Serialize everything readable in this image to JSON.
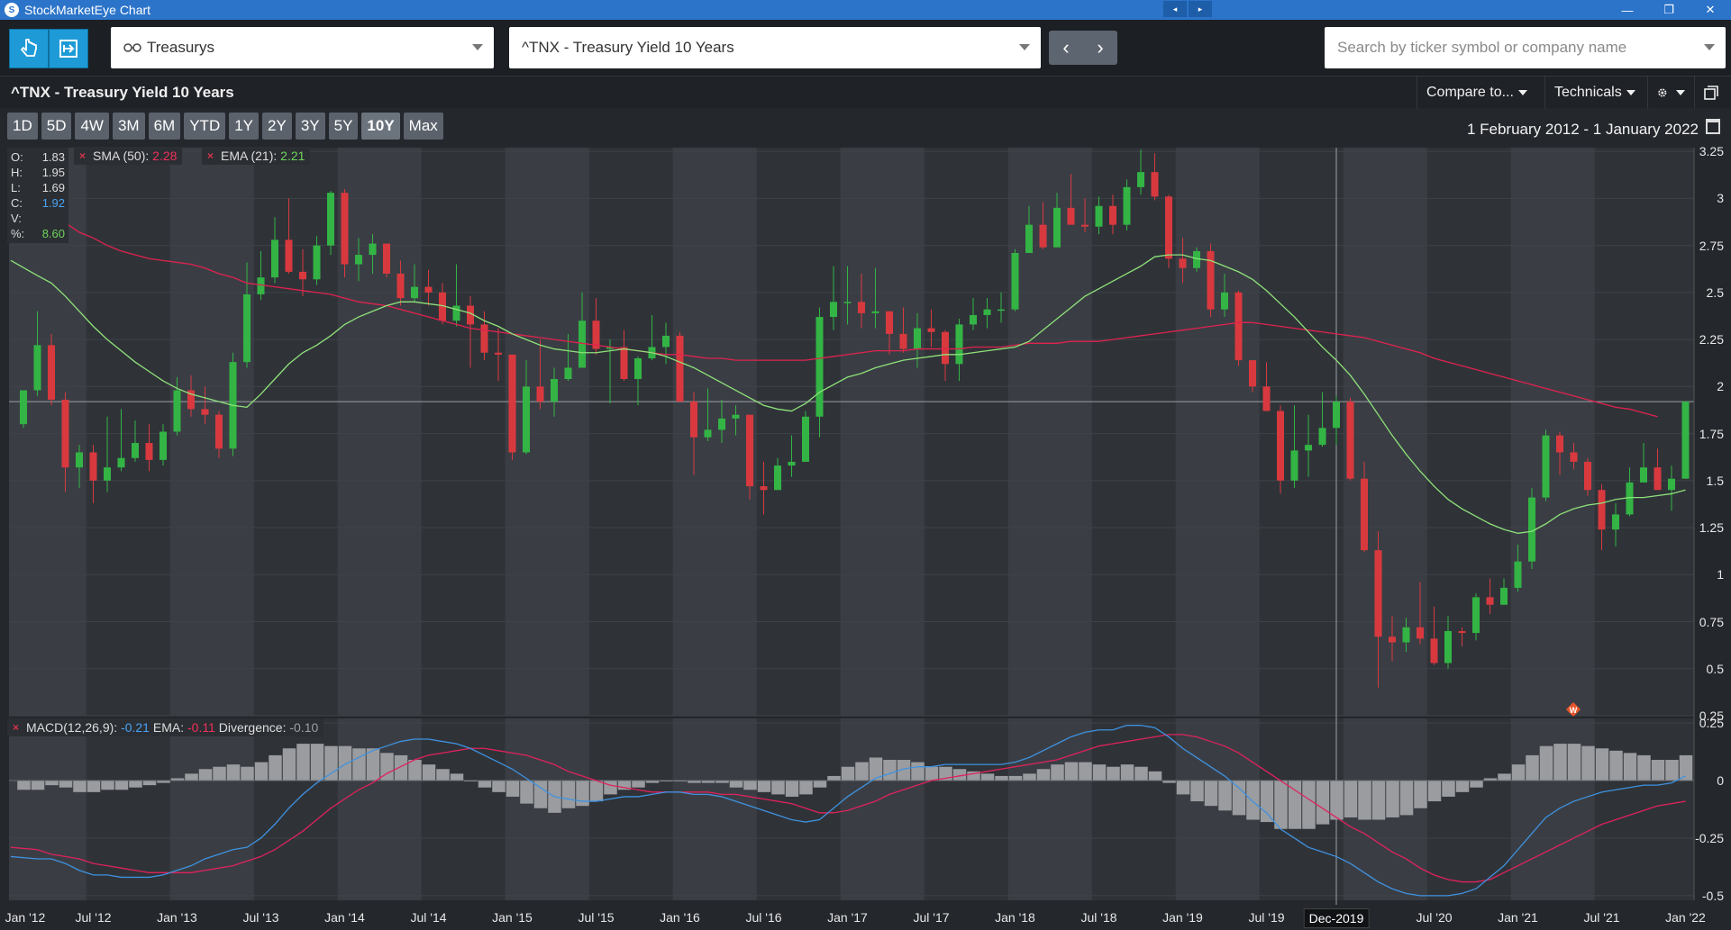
{
  "window": {
    "title": "StockMarketEye Chart",
    "minimize": "—",
    "maximize": "❐",
    "close": "✕",
    "nav_prev": "◂",
    "nav_next": "▸"
  },
  "toolbar": {
    "watchlist": "Treasurys",
    "security": "^TNX - Treasury Yield 10 Years",
    "prev": "‹",
    "next": "›",
    "search_placeholder": "Search by ticker symbol or company name"
  },
  "header": {
    "title": "^TNX - Treasury Yield 10 Years",
    "compare": "Compare to...",
    "technicals": "Technicals",
    "settings_icon": "gear-icon",
    "window_icon": "popout-icon"
  },
  "ranges": {
    "items": [
      "1D",
      "5D",
      "4W",
      "3M",
      "6M",
      "YTD",
      "1Y",
      "2Y",
      "3Y",
      "5Y",
      "10Y",
      "Max"
    ],
    "active": "10Y"
  },
  "date_range": "1 February 2012 - 1 January 2022",
  "ohlc": {
    "o_label": "O:",
    "o": "1.83",
    "h_label": "H:",
    "h": "1.95",
    "l_label": "L:",
    "l": "1.69",
    "c_label": "C:",
    "c": "1.92",
    "v_label": "V:",
    "v": "",
    "pct_label": "%:",
    "pct": "8.60"
  },
  "indicators": {
    "sma_label": "SMA (50):",
    "sma_value": "2.28",
    "ema_label": "EMA (21):",
    "ema_value": "2.21",
    "remove": "×"
  },
  "macd": {
    "label": "MACD(12,26,9):",
    "value": "-0.21",
    "ema_label": "EMA:",
    "ema_value": "-0.11",
    "div_label": "Divergence:",
    "div_value": "-0.10",
    "remove": "×"
  },
  "crosshair": {
    "label": "Dec-2019",
    "price": 1.92
  },
  "colors": {
    "up": "#33b445",
    "down": "#d8393f",
    "sma": "#e0224f",
    "ema": "#8fe27a",
    "macd": "#3f92e0",
    "signal": "#e0225c",
    "histogram": "#9a9ca0"
  },
  "chart_data": {
    "type": "candlestick",
    "xlabels": [
      "Jan '12",
      "Jul '12",
      "Jan '13",
      "Jul '13",
      "Jan '14",
      "Jul '14",
      "Jan '15",
      "Jul '15",
      "Jan '16",
      "Jul '16",
      "Jan '17",
      "Jul '17",
      "Jan '18",
      "Jul '18",
      "Jan '19",
      "Jul '19",
      "Jul '20",
      "Jan '21",
      "Jul '21",
      "Jan '22"
    ],
    "price_ticks": [
      "0.25",
      "0.5",
      "0.75",
      "1",
      "1.25",
      "1.5",
      "1.75",
      "2",
      "2.25",
      "2.5",
      "2.75",
      "3",
      "3.25"
    ],
    "macd_ticks": [
      "-0.5",
      "-0.25",
      "0",
      "0.25"
    ],
    "ylim": [
      0.25,
      3.27
    ],
    "macd_ylim": [
      -0.52,
      0.27
    ],
    "start": "2012-02",
    "months": [
      "2012-02",
      "2012-03",
      "2012-04",
      "2012-05",
      "2012-06",
      "2012-07",
      "2012-08",
      "2012-09",
      "2012-10",
      "2012-11",
      "2012-12",
      "2013-01",
      "2013-02",
      "2013-03",
      "2013-04",
      "2013-05",
      "2013-06",
      "2013-07",
      "2013-08",
      "2013-09",
      "2013-10",
      "2013-11",
      "2013-12",
      "2014-01",
      "2014-02",
      "2014-03",
      "2014-04",
      "2014-05",
      "2014-06",
      "2014-07",
      "2014-08",
      "2014-09",
      "2014-10",
      "2014-11",
      "2014-12",
      "2015-01",
      "2015-02",
      "2015-03",
      "2015-04",
      "2015-05",
      "2015-06",
      "2015-07",
      "2015-08",
      "2015-09",
      "2015-10",
      "2015-11",
      "2015-12",
      "2016-01",
      "2016-02",
      "2016-03",
      "2016-04",
      "2016-05",
      "2016-06",
      "2016-07",
      "2016-08",
      "2016-09",
      "2016-10",
      "2016-11",
      "2016-12",
      "2017-01",
      "2017-02",
      "2017-03",
      "2017-04",
      "2017-05",
      "2017-06",
      "2017-07",
      "2017-08",
      "2017-09",
      "2017-10",
      "2017-11",
      "2017-12",
      "2018-01",
      "2018-02",
      "2018-03",
      "2018-04",
      "2018-05",
      "2018-06",
      "2018-07",
      "2018-08",
      "2018-09",
      "2018-10",
      "2018-11",
      "2018-12",
      "2019-01",
      "2019-02",
      "2019-03",
      "2019-04",
      "2019-05",
      "2019-06",
      "2019-07",
      "2019-08",
      "2019-09",
      "2019-10",
      "2019-11",
      "2019-12",
      "2020-01",
      "2020-02",
      "2020-03",
      "2020-04",
      "2020-05",
      "2020-06",
      "2020-07",
      "2020-08",
      "2020-09",
      "2020-10",
      "2020-11",
      "2020-12",
      "2021-01",
      "2021-02",
      "2021-03",
      "2021-04",
      "2021-05",
      "2021-06",
      "2021-07",
      "2021-08",
      "2021-09",
      "2021-10",
      "2021-11",
      "2021-12",
      "2022-01"
    ],
    "ohlc": [
      [
        1.8,
        1.98,
        1.78,
        1.98
      ],
      [
        1.98,
        2.4,
        1.95,
        2.22
      ],
      [
        2.22,
        2.28,
        1.9,
        1.93
      ],
      [
        1.93,
        1.97,
        1.44,
        1.57
      ],
      [
        1.57,
        1.69,
        1.46,
        1.65
      ],
      [
        1.65,
        1.69,
        1.38,
        1.5
      ],
      [
        1.5,
        1.84,
        1.44,
        1.57
      ],
      [
        1.57,
        1.88,
        1.55,
        1.62
      ],
      [
        1.62,
        1.82,
        1.6,
        1.7
      ],
      [
        1.7,
        1.8,
        1.55,
        1.61
      ],
      [
        1.61,
        1.8,
        1.58,
        1.76
      ],
      [
        1.76,
        2.05,
        1.74,
        1.98
      ],
      [
        1.98,
        2.06,
        1.84,
        1.88
      ],
      [
        1.88,
        2.0,
        1.8,
        1.85
      ],
      [
        1.85,
        1.87,
        1.62,
        1.67
      ],
      [
        1.67,
        2.18,
        1.63,
        2.13
      ],
      [
        2.13,
        2.66,
        2.1,
        2.49
      ],
      [
        2.49,
        2.72,
        2.46,
        2.58
      ],
      [
        2.58,
        2.9,
        2.55,
        2.78
      ],
      [
        2.78,
        3.0,
        2.6,
        2.61
      ],
      [
        2.61,
        2.73,
        2.48,
        2.57
      ],
      [
        2.57,
        2.8,
        2.54,
        2.75
      ],
      [
        2.75,
        3.04,
        2.7,
        3.03
      ],
      [
        3.03,
        3.05,
        2.58,
        2.65
      ],
      [
        2.65,
        2.79,
        2.56,
        2.7
      ],
      [
        2.7,
        2.81,
        2.6,
        2.76
      ],
      [
        2.76,
        2.76,
        2.58,
        2.6
      ],
      [
        2.6,
        2.67,
        2.43,
        2.47
      ],
      [
        2.47,
        2.65,
        2.45,
        2.53
      ],
      [
        2.53,
        2.62,
        2.43,
        2.5
      ],
      [
        2.5,
        2.55,
        2.33,
        2.35
      ],
      [
        2.35,
        2.65,
        2.32,
        2.43
      ],
      [
        2.43,
        2.48,
        2.1,
        2.33
      ],
      [
        2.33,
        2.4,
        2.14,
        2.18
      ],
      [
        2.18,
        2.31,
        2.03,
        2.17
      ],
      [
        2.17,
        2.12,
        1.61,
        1.65
      ],
      [
        1.65,
        2.14,
        1.64,
        2.0
      ],
      [
        2.0,
        2.25,
        1.88,
        1.92
      ],
      [
        1.92,
        2.1,
        1.84,
        2.04
      ],
      [
        2.04,
        2.28,
        2.03,
        2.1
      ],
      [
        2.1,
        2.5,
        2.1,
        2.35
      ],
      [
        2.35,
        2.47,
        2.17,
        2.2
      ],
      [
        2.2,
        2.25,
        1.91,
        2.21
      ],
      [
        2.21,
        2.3,
        2.03,
        2.04
      ],
      [
        2.04,
        2.16,
        1.9,
        2.15
      ],
      [
        2.15,
        2.38,
        2.14,
        2.21
      ],
      [
        2.21,
        2.34,
        2.12,
        2.27
      ],
      [
        2.27,
        2.29,
        1.97,
        1.92
      ],
      [
        1.92,
        1.97,
        1.53,
        1.73
      ],
      [
        1.73,
        1.99,
        1.71,
        1.77
      ],
      [
        1.77,
        1.93,
        1.7,
        1.83
      ],
      [
        1.83,
        1.9,
        1.74,
        1.85
      ],
      [
        1.85,
        1.8,
        1.4,
        1.47
      ],
      [
        1.47,
        1.6,
        1.32,
        1.45
      ],
      [
        1.45,
        1.62,
        1.48,
        1.58
      ],
      [
        1.58,
        1.74,
        1.52,
        1.6
      ],
      [
        1.6,
        1.87,
        1.6,
        1.84
      ],
      [
        1.84,
        2.42,
        1.73,
        2.37
      ],
      [
        2.37,
        2.64,
        2.3,
        2.45
      ],
      [
        2.45,
        2.64,
        2.33,
        2.45
      ],
      [
        2.45,
        2.6,
        2.31,
        2.39
      ],
      [
        2.39,
        2.63,
        2.31,
        2.4
      ],
      [
        2.4,
        2.4,
        2.17,
        2.28
      ],
      [
        2.28,
        2.42,
        2.18,
        2.2
      ],
      [
        2.2,
        2.39,
        2.1,
        2.31
      ],
      [
        2.31,
        2.41,
        2.21,
        2.29
      ],
      [
        2.29,
        2.3,
        2.03,
        2.12
      ],
      [
        2.12,
        2.36,
        2.03,
        2.33
      ],
      [
        2.33,
        2.47,
        2.3,
        2.38
      ],
      [
        2.38,
        2.47,
        2.31,
        2.41
      ],
      [
        2.41,
        2.5,
        2.34,
        2.41
      ],
      [
        2.41,
        2.73,
        2.4,
        2.71
      ],
      [
        2.71,
        2.96,
        2.71,
        2.86
      ],
      [
        2.86,
        2.98,
        2.73,
        2.74
      ],
      [
        2.74,
        3.03,
        2.75,
        2.95
      ],
      [
        2.95,
        3.13,
        2.94,
        2.86
      ],
      [
        2.86,
        3.0,
        2.82,
        2.85
      ],
      [
        2.85,
        3.01,
        2.81,
        2.96
      ],
      [
        2.96,
        3.02,
        2.81,
        2.86
      ],
      [
        2.86,
        3.1,
        2.83,
        3.06
      ],
      [
        3.06,
        3.26,
        3.02,
        3.14
      ],
      [
        3.14,
        3.24,
        2.99,
        3.01
      ],
      [
        3.01,
        3.02,
        2.63,
        2.68
      ],
      [
        2.68,
        2.79,
        2.55,
        2.63
      ],
      [
        2.63,
        2.74,
        2.61,
        2.72
      ],
      [
        2.72,
        2.76,
        2.37,
        2.41
      ],
      [
        2.41,
        2.6,
        2.37,
        2.5
      ],
      [
        2.5,
        2.51,
        2.11,
        2.14
      ],
      [
        2.14,
        2.14,
        1.97,
        2.0
      ],
      [
        2.0,
        2.13,
        1.97,
        1.87
      ],
      [
        1.87,
        1.9,
        1.43,
        1.5
      ],
      [
        1.5,
        1.9,
        1.46,
        1.66
      ],
      [
        1.66,
        1.85,
        1.52,
        1.69
      ],
      [
        1.69,
        1.97,
        1.68,
        1.78
      ],
      [
        1.78,
        1.95,
        1.69,
        1.92
      ],
      [
        1.92,
        1.94,
        1.5,
        1.51
      ],
      [
        1.51,
        1.6,
        1.12,
        1.13
      ],
      [
        1.13,
        1.23,
        0.4,
        0.67
      ],
      [
        0.67,
        0.78,
        0.54,
        0.64
      ],
      [
        0.64,
        0.77,
        0.59,
        0.72
      ],
      [
        0.72,
        0.96,
        0.63,
        0.66
      ],
      [
        0.66,
        0.83,
        0.52,
        0.53
      ],
      [
        0.53,
        0.78,
        0.5,
        0.7
      ],
      [
        0.7,
        0.72,
        0.62,
        0.69
      ],
      [
        0.69,
        0.9,
        0.65,
        0.88
      ],
      [
        0.88,
        0.98,
        0.79,
        0.84
      ],
      [
        0.84,
        0.98,
        0.85,
        0.93
      ],
      [
        0.93,
        1.16,
        0.91,
        1.07
      ],
      [
        1.07,
        1.46,
        1.03,
        1.41
      ],
      [
        1.41,
        1.77,
        1.39,
        1.74
      ],
      [
        1.74,
        1.76,
        1.53,
        1.65
      ],
      [
        1.65,
        1.7,
        1.56,
        1.6
      ],
      [
        1.6,
        1.62,
        1.42,
        1.45
      ],
      [
        1.45,
        1.48,
        1.13,
        1.24
      ],
      [
        1.24,
        1.38,
        1.15,
        1.32
      ],
      [
        1.32,
        1.57,
        1.31,
        1.49
      ],
      [
        1.49,
        1.7,
        1.52,
        1.57
      ],
      [
        1.57,
        1.67,
        1.45,
        1.45
      ],
      [
        1.45,
        1.58,
        1.34,
        1.51
      ],
      [
        1.51,
        1.89,
        1.52,
        1.92
      ]
    ],
    "sma50": [
      3.0,
      2.96,
      2.91,
      2.87,
      2.82,
      2.79,
      2.75,
      2.72,
      2.7,
      2.68,
      2.67,
      2.66,
      2.65,
      2.63,
      2.6,
      2.58,
      2.55,
      2.54,
      2.53,
      2.52,
      2.51,
      2.5,
      2.49,
      2.47,
      2.45,
      2.44,
      2.43,
      2.41,
      2.39,
      2.37,
      2.35,
      2.33,
      2.31,
      2.3,
      2.29,
      2.28,
      2.27,
      2.26,
      2.25,
      2.24,
      2.23,
      2.22,
      2.21,
      2.2,
      2.19,
      2.18,
      2.17,
      2.17,
      2.16,
      2.15,
      2.15,
      2.14,
      2.14,
      2.14,
      2.14,
      2.14,
      2.14,
      2.15,
      2.16,
      2.17,
      2.18,
      2.19,
      2.19,
      2.19,
      2.2,
      2.2,
      2.2,
      2.2,
      2.21,
      2.21,
      2.21,
      2.22,
      2.23,
      2.23,
      2.23,
      2.24,
      2.24,
      2.24,
      2.25,
      2.26,
      2.27,
      2.28,
      2.29,
      2.3,
      2.31,
      2.32,
      2.33,
      2.34,
      2.34,
      2.33,
      2.32,
      2.31,
      2.3,
      2.29,
      2.28,
      2.27,
      2.26,
      2.24,
      2.22,
      2.2,
      2.18,
      2.15,
      2.13,
      2.11,
      2.09,
      2.07,
      2.05,
      2.03,
      2.01,
      1.99,
      1.97,
      1.95,
      1.93,
      1.91,
      1.89,
      1.88,
      1.86,
      1.84
    ],
    "ema21": [
      2.67,
      2.59,
      2.55,
      2.48,
      2.4,
      2.32,
      2.25,
      2.19,
      2.13,
      2.08,
      2.03,
      1.99,
      1.96,
      1.94,
      1.92,
      1.9,
      1.89,
      1.96,
      2.04,
      2.12,
      2.18,
      2.22,
      2.27,
      2.33,
      2.37,
      2.4,
      2.43,
      2.45,
      2.45,
      2.44,
      2.43,
      2.41,
      2.39,
      2.35,
      2.32,
      2.28,
      2.25,
      2.22,
      2.2,
      2.19,
      2.18,
      2.18,
      2.19,
      2.2,
      2.19,
      2.18,
      2.16,
      2.13,
      2.1,
      2.06,
      2.02,
      1.98,
      1.94,
      1.9,
      1.88,
      1.87,
      1.91,
      1.97,
      2.01,
      2.05,
      2.07,
      2.1,
      2.12,
      2.14,
      2.15,
      2.16,
      2.17,
      2.17,
      2.18,
      2.19,
      2.2,
      2.21,
      2.24,
      2.3,
      2.36,
      2.42,
      2.48,
      2.52,
      2.56,
      2.6,
      2.64,
      2.69,
      2.7,
      2.7,
      2.68,
      2.67,
      2.64,
      2.61,
      2.57,
      2.51,
      2.44,
      2.37,
      2.29,
      2.21,
      2.14,
      2.06,
      1.96,
      1.85,
      1.74,
      1.64,
      1.55,
      1.47,
      1.4,
      1.35,
      1.31,
      1.27,
      1.24,
      1.22,
      1.23,
      1.27,
      1.32,
      1.35,
      1.37,
      1.38,
      1.4,
      1.41,
      1.41,
      1.42,
      1.43,
      1.45
    ],
    "macd": [
      -0.33,
      -0.34,
      -0.34,
      -0.36,
      -0.39,
      -0.41,
      -0.41,
      -0.42,
      -0.42,
      -0.42,
      -0.41,
      -0.39,
      -0.37,
      -0.34,
      -0.32,
      -0.3,
      -0.29,
      -0.25,
      -0.19,
      -0.12,
      -0.06,
      -0.01,
      0.03,
      0.07,
      0.1,
      0.13,
      0.15,
      0.17,
      0.18,
      0.18,
      0.17,
      0.16,
      0.14,
      0.11,
      0.08,
      0.05,
      0.01,
      -0.03,
      -0.07,
      -0.08,
      -0.09,
      -0.09,
      -0.08,
      -0.07,
      -0.07,
      -0.06,
      -0.05,
      -0.05,
      -0.06,
      -0.06,
      -0.07,
      -0.09,
      -0.11,
      -0.13,
      -0.15,
      -0.17,
      -0.18,
      -0.17,
      -0.12,
      -0.07,
      -0.03,
      0.01,
      0.03,
      0.05,
      0.06,
      0.06,
      0.07,
      0.07,
      0.07,
      0.07,
      0.07,
      0.08,
      0.1,
      0.13,
      0.16,
      0.19,
      0.21,
      0.22,
      0.22,
      0.24,
      0.24,
      0.23,
      0.19,
      0.14,
      0.1,
      0.06,
      0.02,
      -0.03,
      -0.09,
      -0.14,
      -0.21,
      -0.25,
      -0.29,
      -0.31,
      -0.33,
      -0.36,
      -0.4,
      -0.44,
      -0.47,
      -0.49,
      -0.5,
      -0.5,
      -0.5,
      -0.49,
      -0.47,
      -0.42,
      -0.37,
      -0.3,
      -0.23,
      -0.16,
      -0.12,
      -0.09,
      -0.07,
      -0.05,
      -0.04,
      -0.03,
      -0.02,
      -0.02,
      -0.01,
      0.02
    ],
    "signal": [
      -0.29,
      -0.3,
      -0.32,
      -0.33,
      -0.34,
      -0.36,
      -0.37,
      -0.38,
      -0.39,
      -0.4,
      -0.4,
      -0.4,
      -0.4,
      -0.39,
      -0.38,
      -0.37,
      -0.35,
      -0.33,
      -0.3,
      -0.26,
      -0.22,
      -0.17,
      -0.12,
      -0.08,
      -0.04,
      -0.01,
      0.03,
      0.06,
      0.09,
      0.11,
      0.12,
      0.13,
      0.14,
      0.14,
      0.13,
      0.12,
      0.11,
      0.09,
      0.07,
      0.04,
      0.02,
      0.0,
      -0.02,
      -0.03,
      -0.04,
      -0.05,
      -0.05,
      -0.05,
      -0.05,
      -0.05,
      -0.06,
      -0.06,
      -0.07,
      -0.08,
      -0.09,
      -0.1,
      -0.12,
      -0.14,
      -0.14,
      -0.13,
      -0.11,
      -0.09,
      -0.06,
      -0.04,
      -0.02,
      0.0,
      0.01,
      0.02,
      0.03,
      0.04,
      0.05,
      0.06,
      0.07,
      0.08,
      0.09,
      0.11,
      0.13,
      0.15,
      0.16,
      0.17,
      0.18,
      0.19,
      0.2,
      0.2,
      0.19,
      0.17,
      0.15,
      0.12,
      0.08,
      0.04,
      0.0,
      -0.04,
      -0.08,
      -0.12,
      -0.16,
      -0.2,
      -0.23,
      -0.27,
      -0.31,
      -0.34,
      -0.38,
      -0.41,
      -0.43,
      -0.44,
      -0.44,
      -0.43,
      -0.4,
      -0.37,
      -0.34,
      -0.31,
      -0.28,
      -0.25,
      -0.22,
      -0.19,
      -0.17,
      -0.15,
      -0.13,
      -0.11,
      -0.1,
      -0.09
    ]
  }
}
